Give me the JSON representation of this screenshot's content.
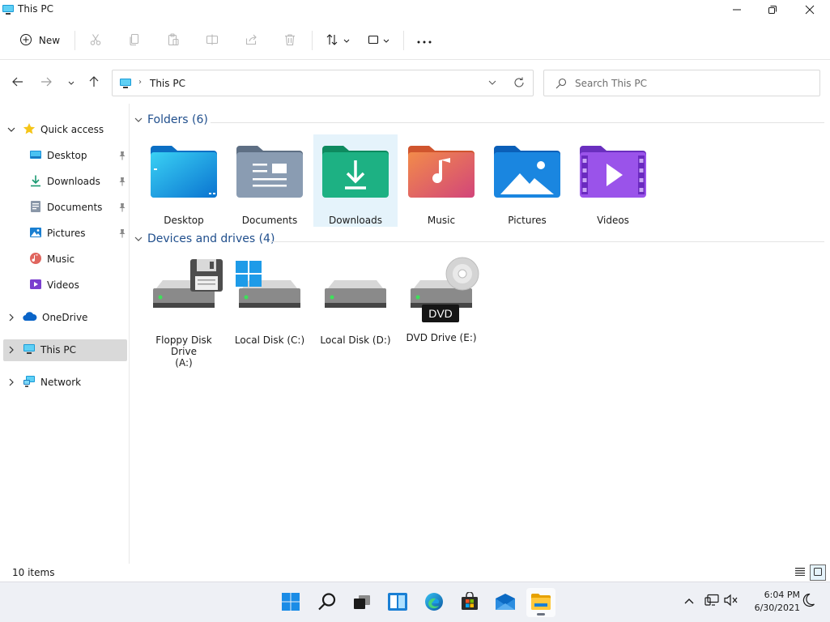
{
  "window": {
    "title": "This PC",
    "controls": {
      "minimize": "minimize-icon",
      "maximize": "restore-icon",
      "close": "close-icon"
    }
  },
  "toolbar": {
    "new_label": "New",
    "icons": [
      "cut-icon",
      "copy-icon",
      "paste-icon",
      "rename-icon",
      "share-icon",
      "delete-icon",
      "sort-icon",
      "view-icon",
      "more-icon"
    ]
  },
  "address": {
    "path": "This PC",
    "search_placeholder": "Search This PC"
  },
  "sidebar": {
    "quick_access": "Quick access",
    "items": [
      {
        "label": "Desktop",
        "icon": "desktop-icon",
        "pinned": true
      },
      {
        "label": "Downloads",
        "icon": "downloads-icon",
        "pinned": true
      },
      {
        "label": "Documents",
        "icon": "documents-icon",
        "pinned": true
      },
      {
        "label": "Pictures",
        "icon": "pictures-icon",
        "pinned": true
      },
      {
        "label": "Music",
        "icon": "music-icon",
        "pinned": false
      },
      {
        "label": "Videos",
        "icon": "videos-icon",
        "pinned": false
      }
    ],
    "onedrive": "OneDrive",
    "this_pc": "This PC",
    "network": "Network",
    "selected": "This PC"
  },
  "content": {
    "folders_header": "Folders (6)",
    "folders": [
      {
        "label": "Desktop",
        "icon": "desktop-folder-icon"
      },
      {
        "label": "Documents",
        "icon": "documents-folder-icon"
      },
      {
        "label": "Downloads",
        "icon": "downloads-folder-icon"
      },
      {
        "label": "Music",
        "icon": "music-folder-icon"
      },
      {
        "label": "Pictures",
        "icon": "pictures-folder-icon"
      },
      {
        "label": "Videos",
        "icon": "videos-folder-icon"
      }
    ],
    "selected_folder": "Downloads",
    "drives_header": "Devices and drives (4)",
    "drives": [
      {
        "label_line1": "Floppy Disk Drive",
        "label_line2": "(A:)",
        "icon": "floppy-drive-icon"
      },
      {
        "label_line1": "Local Disk (C:)",
        "label_line2": "",
        "icon": "local-disk-windows-icon"
      },
      {
        "label_line1": "Local Disk (D:)",
        "label_line2": "",
        "icon": "local-disk-icon"
      },
      {
        "label_line1": "DVD Drive (E:)",
        "label_line2": "",
        "icon": "dvd-drive-icon"
      }
    ],
    "dvd_badge": "DVD"
  },
  "status": {
    "item_count": "10 items"
  },
  "taskbar": {
    "apps": [
      "start-icon",
      "search-icon",
      "task-view-icon",
      "widgets-icon",
      "edge-icon",
      "store-icon",
      "mail-icon",
      "file-explorer-icon"
    ],
    "active_app": "file-explorer-icon",
    "time": "6:04 PM",
    "date": "6/30/2021"
  },
  "colors": {
    "accent": "#0067c0",
    "selection": "#e5f3fb",
    "nav_selected": "#d9d9d9",
    "section_header": "#1f4e8c",
    "taskbar": "#eef0f5"
  }
}
